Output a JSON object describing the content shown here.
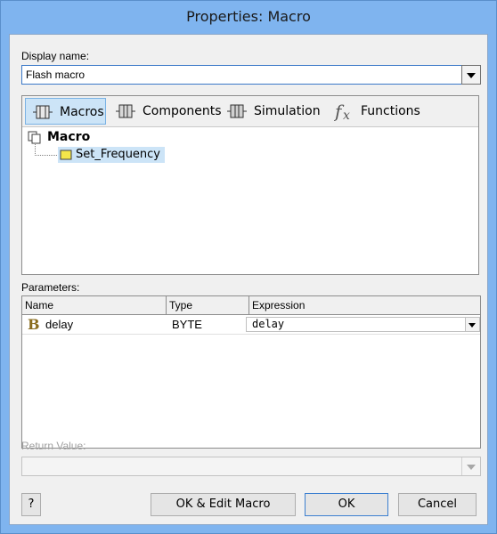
{
  "window": {
    "title": "Properties: Macro"
  },
  "display_name": {
    "label": "Display name:",
    "value": "Flash macro"
  },
  "tabs": [
    {
      "label": "Macros",
      "icon": "macros-icon",
      "active": true
    },
    {
      "label": "Components",
      "icon": "components-icon",
      "active": false
    },
    {
      "label": "Simulation",
      "icon": "simulation-icon",
      "active": false
    },
    {
      "label": "Functions",
      "icon": "fx-icon",
      "active": false
    }
  ],
  "tree": {
    "root": "Macro",
    "child": "Set_Frequency"
  },
  "parameters": {
    "label": "Parameters:",
    "columns": [
      "Name",
      "Type",
      "Expression"
    ],
    "rows": [
      {
        "name": "delay",
        "type": "BYTE",
        "expression": "delay",
        "type_icon": "B"
      }
    ]
  },
  "return_value": {
    "label": "Return Value:",
    "value": ""
  },
  "buttons": {
    "help": "?",
    "ok_edit": "OK & Edit Macro",
    "ok": "OK",
    "cancel": "Cancel"
  },
  "colors": {
    "titlebar": "#7fb4ef",
    "selection": "#cce4f7",
    "accent": "#3c7fd0"
  }
}
